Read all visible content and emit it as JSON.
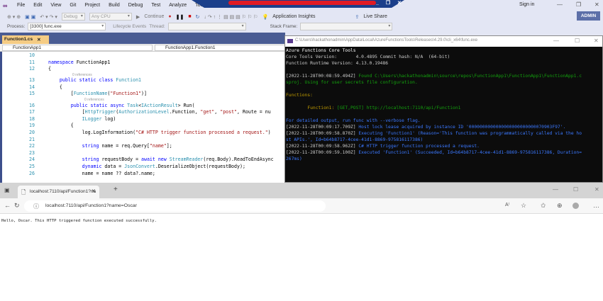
{
  "vs": {
    "menu": [
      "File",
      "Edit",
      "View",
      "Git",
      "Project",
      "Build",
      "Debug",
      "Test",
      "Analyze",
      "Tools"
    ],
    "sign_in": "Sign in",
    "toolbar": {
      "config": "Debug",
      "platform": "Any CPU",
      "continue": "Continue",
      "app_insights": "Application Insights",
      "live_share": "Live Share",
      "admin": "ADMIN"
    },
    "process_label": "Process:",
    "process_value": "[3300] func.exe",
    "lifecycle": "Lifecycle Events",
    "thread_label": "Thread:",
    "stack_frame": "Stack Frame:",
    "doc_tab": "Function1.cs",
    "nav_project": "FunctionApp1",
    "nav_class": "FunctionApp1.Function1",
    "code": [
      {
        "n": "10",
        "s": []
      },
      {
        "n": "11",
        "s": [
          [
            "k",
            "namespace "
          ],
          [
            "p",
            "FunctionApp1"
          ]
        ]
      },
      {
        "n": "12",
        "s": [
          [
            "p",
            "{"
          ]
        ]
      },
      {
        "ref": "0 references",
        "i": 1
      },
      {
        "n": "13",
        "s": [
          [
            "p",
            "    "
          ],
          [
            "k",
            "public static class "
          ],
          [
            "t",
            "Function1"
          ]
        ]
      },
      {
        "n": "14",
        "s": [
          [
            "p",
            "    {"
          ]
        ]
      },
      {
        "n": "15",
        "s": [
          [
            "p",
            "        ["
          ],
          [
            "t",
            "FunctionName"
          ],
          [
            "p",
            "("
          ],
          [
            "s",
            "\"Function1\""
          ],
          [
            "p",
            ")]"
          ]
        ]
      },
      {
        "ref": "0 references",
        "i": 2
      },
      {
        "n": "16",
        "s": [
          [
            "p",
            "        "
          ],
          [
            "k",
            "public static async "
          ],
          [
            "t",
            "Task"
          ],
          [
            "p",
            "<"
          ],
          [
            "t",
            "IActionResult"
          ],
          [
            "p",
            "> Run("
          ]
        ]
      },
      {
        "n": "17",
        "s": [
          [
            "p",
            "            ["
          ],
          [
            "t",
            "HttpTrigger"
          ],
          [
            "p",
            "("
          ],
          [
            "t",
            "AuthorizationLevel"
          ],
          [
            "p",
            ".Function, "
          ],
          [
            "s",
            "\"get\""
          ],
          [
            "p",
            ", "
          ],
          [
            "s",
            "\"post\""
          ],
          [
            "p",
            ", Route = nu"
          ]
        ]
      },
      {
        "n": "18",
        "s": [
          [
            "p",
            "            "
          ],
          [
            "t",
            "ILogger"
          ],
          [
            "p",
            " log)"
          ]
        ]
      },
      {
        "n": "19",
        "s": [
          [
            "p",
            "        {"
          ]
        ]
      },
      {
        "n": "20",
        "s": [
          [
            "p",
            "            log.LogInformation("
          ],
          [
            "s",
            "\"C# HTTP trigger function processed a request.\""
          ],
          [
            "p",
            ")"
          ]
        ]
      },
      {
        "n": "21",
        "s": []
      },
      {
        "n": "22",
        "s": [
          [
            "p",
            "            "
          ],
          [
            "k",
            "string"
          ],
          [
            "p",
            " name = req.Query["
          ],
          [
            "s",
            "\"name\""
          ],
          [
            "p",
            "];"
          ]
        ]
      },
      {
        "n": "23",
        "s": []
      },
      {
        "n": "24",
        "s": [
          [
            "p",
            "            "
          ],
          [
            "k",
            "string"
          ],
          [
            "p",
            " requestBody = "
          ],
          [
            "k",
            "await new "
          ],
          [
            "t",
            "StreamReader"
          ],
          [
            "p",
            "(req.Body).ReadToEndAsync"
          ]
        ]
      },
      {
        "n": "25",
        "s": [
          [
            "p",
            "            "
          ],
          [
            "k",
            "dynamic"
          ],
          [
            "p",
            " data = "
          ],
          [
            "t",
            "JsonConvert"
          ],
          [
            "p",
            ".DeserializeObject(requestBody);"
          ]
        ]
      },
      {
        "n": "26",
        "s": [
          [
            "p",
            "            name = name ?? data?.name;"
          ]
        ]
      }
    ]
  },
  "console": {
    "title": "C:\\Users\\hackathonadmin\\AppData\\Local\\AzureFunctionsTools\\Releases\\4.29.0\\cli_x64\\func.exe",
    "lines": [
      [
        [
          "cw",
          "Azure Functions Core Tools"
        ]
      ],
      [
        [
          "cg",
          "Core Tools Version:       4.0.4895 Commit hash: N/A  (64-bit)"
        ]
      ],
      [
        [
          "cg",
          "Function Runtime Version: 4.13.0.19486"
        ]
      ],
      [],
      [
        [
          "cg",
          "[2022-11-28T00:08:59.494Z] "
        ],
        [
          "cgr",
          "Found C:\\Users\\hackathonadmin\\source\\repos\\FunctionApp1\\FunctionApp1\\FunctionApp1.c"
        ]
      ],
      [
        [
          "cgr",
          "sproj. Using for user secrets file configuration."
        ]
      ],
      [],
      [
        [
          "cy",
          "Functions:"
        ]
      ],
      [],
      [
        [
          "cy",
          "        Function1: "
        ],
        [
          "cgr",
          "[GET,POST] http://localhost:7110/api/Function1"
        ]
      ],
      [],
      [
        [
          "cb",
          "For detailed output, run func with --verbose flag."
        ]
      ],
      [
        [
          "cg",
          "[2022-11-28T00:09:17.709Z] "
        ],
        [
          "cb",
          "Host lock lease acquired by instance ID '0000000000000000000000000070903F97'."
        ]
      ],
      [
        [
          "cg",
          "[2022-11-28T00:09:58.870Z] "
        ],
        [
          "cb",
          "Executing 'Function1' (Reason='This function was programmatically called via the ho"
        ]
      ],
      [
        [
          "cb",
          "st APIs.', Id=b64b8717-4cee-41d1-8869-975816117386)"
        ]
      ],
      [
        [
          "cg",
          "[2022-11-28T00:09:58.962Z] "
        ],
        [
          "cb",
          "C# HTTP trigger function processed a request."
        ]
      ],
      [
        [
          "cg",
          "[2022-11-28T00:09:59.100Z] "
        ],
        [
          "cb",
          "Executed 'Function1' (Succeeded, Id=b64b8717-4cee-41d1-8869-975816117386, Duration="
        ]
      ],
      [
        [
          "cb",
          "267ms)"
        ]
      ]
    ]
  },
  "browser": {
    "tab_title": "localhost:7110/api/Function1?na",
    "url": "localhost:7110/api/Function1?name=Oscar",
    "content": "Hello, Oscar. This HTTP triggered function executed successfully."
  }
}
